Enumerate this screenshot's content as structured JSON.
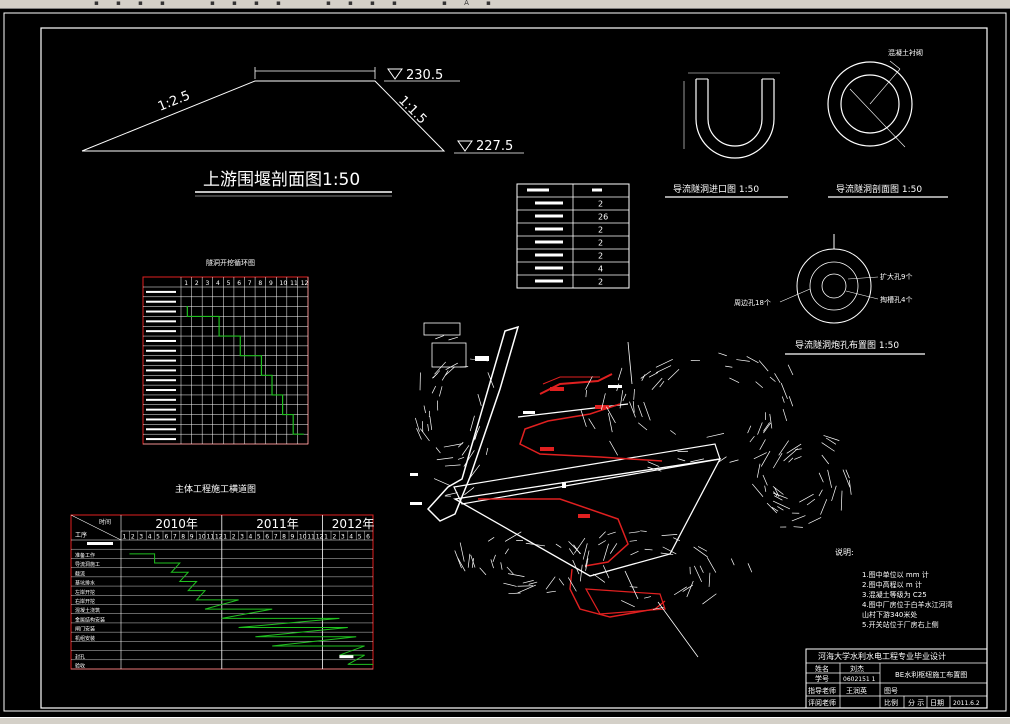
{
  "toolbar": {
    "icons": [
      "open-icon",
      "save-icon",
      "print-icon",
      "cut-icon",
      "copy-icon",
      "paste-icon",
      "undo-icon",
      "redo-icon",
      "pan-icon",
      "zoom-icon",
      "zoom-window-icon",
      "properties-icon",
      "layer-icon",
      "text-style-icon",
      "dim-style-icon"
    ],
    "text_style_label": "A"
  },
  "drawing": {
    "upstream": {
      "title": "上游围堰剖面图1:50",
      "slope_left": "1:2.5",
      "slope_right": "1:1.5",
      "elev_top": "230.5",
      "elev_bottom": "227.5"
    },
    "tunnel_inlet_title": "导流隧洞进口图 1:50",
    "tunnel_section_title": "导流隧洞剖面图 1:50",
    "tunnel_lining_label": "混凝土衬砌",
    "tunnel_blast_title": "导流隧洞炮孔布置图 1:50",
    "blast_labels": [
      "扩大孔9个",
      "掏槽孔4个",
      "周边孔18个"
    ],
    "qty_table": {
      "values": [
        "2",
        "26",
        "2",
        "2",
        "2",
        "4",
        "2"
      ]
    },
    "progress_chart": {
      "title": "隧洞开挖循环图",
      "columns": [
        "1",
        "2",
        "3",
        "4",
        "5",
        "6",
        "7",
        "8",
        "9",
        "10",
        "11",
        "12"
      ]
    },
    "schedule": {
      "title": "主体工程施工横道图",
      "years": [
        "2010年",
        "2011年",
        "2012年"
      ],
      "header_top": "时间",
      "header_left": "工序",
      "row_labels": [
        "",
        "准备工作",
        "导流洞施工",
        "截流",
        "基坑排水",
        "左岸开挖",
        "右岸开挖",
        "混凝土浇筑",
        "金属结构安装",
        "闸门安装",
        "机组安装",
        "",
        "封孔",
        "验收"
      ]
    },
    "notes": {
      "header": "说明:",
      "items": [
        "1.图中单位以 mm 计",
        "2.图中高程以 m 计",
        "3.混凝土等级为 C25",
        "4.图中厂房位于白羊水江河湾",
        "  山村下游340米处",
        "5.开关站位于厂房右上侧"
      ]
    },
    "title_block": {
      "school": "河海大学水利水电工程专业毕业设计",
      "name_label": "姓名",
      "name": "刘杰",
      "id_label": "学号",
      "id": "0602151 1",
      "drawing_title": "BE水利枢纽施工布置图",
      "advisor_label": "指导老师",
      "advisor": "王润英",
      "page_label": "图号",
      "reviewer_label": "评阅老师",
      "scale_label": "比例",
      "split_label": "分 示",
      "date_label": "日期",
      "date": "2011.6.2"
    }
  }
}
